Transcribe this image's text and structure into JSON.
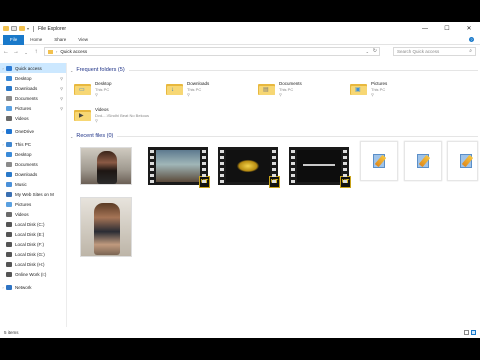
{
  "window": {
    "title": "File Explorer",
    "controls": {
      "minimize": "—",
      "maximize": "☐",
      "close": "✕"
    }
  },
  "ribbon": {
    "tabs": [
      {
        "label": "File",
        "active": true
      },
      {
        "label": "Home"
      },
      {
        "label": "Share"
      },
      {
        "label": "View"
      }
    ],
    "help": "?"
  },
  "address": {
    "back": "←",
    "forward": "→",
    "history": "⌄",
    "up": "↑",
    "breadcrumb": "Quick access",
    "separator": "›",
    "dropdown": "⌄",
    "refresh": "↻"
  },
  "search": {
    "placeholder": "Search Quick access",
    "icon": "search-icon"
  },
  "sidebar": {
    "items": [
      {
        "label": "Quick access",
        "icon": "star-icon",
        "color": "#2b7bd6",
        "expand": "›",
        "selected": true
      },
      {
        "label": "Desktop",
        "icon": "desktop-icon",
        "color": "#3a8ad8",
        "pinned": true
      },
      {
        "label": "Downloads",
        "icon": "download-icon",
        "color": "#2a79c9",
        "pinned": true
      },
      {
        "label": "Documents",
        "icon": "documents-icon",
        "color": "#8a8a8a",
        "pinned": true
      },
      {
        "label": "Pictures",
        "icon": "pictures-icon",
        "color": "#5aa0e0",
        "pinned": true
      },
      {
        "label": "Videos",
        "icon": "videos-icon",
        "color": "#6a6a6a"
      },
      {
        "label": "OneDrive",
        "icon": "cloud-icon",
        "color": "#1e74d1",
        "expand": "›",
        "gapBefore": true
      },
      {
        "label": "This PC",
        "icon": "computer-icon",
        "color": "#3f86cf",
        "expand": "›",
        "gapBefore": true
      },
      {
        "label": "Desktop",
        "icon": "desktop-icon",
        "color": "#3a8ad8"
      },
      {
        "label": "Documents",
        "icon": "documents-icon",
        "color": "#8a8a8a"
      },
      {
        "label": "Downloads",
        "icon": "download-icon",
        "color": "#2a79c9"
      },
      {
        "label": "Music",
        "icon": "music-icon",
        "color": "#4a90d9"
      },
      {
        "label": "My Web Sites on M",
        "icon": "network-folder-icon",
        "color": "#3a6fb2"
      },
      {
        "label": "Pictures",
        "icon": "pictures-icon",
        "color": "#5aa0e0"
      },
      {
        "label": "Videos",
        "icon": "videos-icon",
        "color": "#6a6a6a"
      },
      {
        "label": "Local Disk (C:)",
        "icon": "drive-icon",
        "color": "#555555"
      },
      {
        "label": "Local Disk (E:)",
        "icon": "drive-icon",
        "color": "#555555"
      },
      {
        "label": "Local Disk (F:)",
        "icon": "drive-icon",
        "color": "#555555"
      },
      {
        "label": "Local Disk (G:)",
        "icon": "drive-icon",
        "color": "#555555"
      },
      {
        "label": "Local Disk (H:)",
        "icon": "drive-icon",
        "color": "#555555"
      },
      {
        "label": "Online Work (I:)",
        "icon": "drive-icon",
        "color": "#555555"
      },
      {
        "label": "Network",
        "icon": "network-icon",
        "color": "#2f74c4",
        "expand": "›",
        "gapBefore": true
      }
    ]
  },
  "content": {
    "frequent_header": "Frequent folders (5)",
    "recent_header": "Recent files (0)",
    "collapse_glyph": "⌄",
    "folders": [
      {
        "name": "Desktop",
        "sub": "This PC",
        "icon": "desktop-folder-icon",
        "glyph": "▭",
        "glyph_color": "#2b7bd6"
      },
      {
        "name": "Downloads",
        "sub": "This PC",
        "icon": "downloads-folder-icon",
        "glyph": "↓",
        "glyph_color": "#1e6fc1"
      },
      {
        "name": "Documents",
        "sub": "This PC",
        "icon": "documents-folder-icon",
        "glyph": "▤",
        "glyph_color": "#7a7a7a"
      },
      {
        "name": "Pictures",
        "sub": "This PC",
        "icon": "pictures-folder-icon",
        "glyph": "▣",
        "glyph_color": "#3f8fd8"
      },
      {
        "name": "Videos",
        "sub": "Dvd-...\\Sindhi Beat No Bekous",
        "icon": "videos-folder-icon",
        "glyph": "▶",
        "glyph_color": "#444444"
      }
    ],
    "pin_glyph": "⚲",
    "recent": [
      {
        "kind": "photo",
        "icon": "photo-thumbnail-1"
      },
      {
        "kind": "video",
        "icon": "video-thumbnail-1",
        "badge": "UT"
      },
      {
        "kind": "video",
        "icon": "video-thumbnail-2",
        "badge": "UT"
      },
      {
        "kind": "video",
        "icon": "video-thumbnail-3",
        "badge": "UT"
      },
      {
        "kind": "doc",
        "icon": "document-thumbnail-1"
      },
      {
        "kind": "doc",
        "icon": "document-thumbnail-2"
      },
      {
        "kind": "doc",
        "icon": "document-thumbnail-3"
      },
      {
        "kind": "photo",
        "icon": "photo-thumbnail-2"
      }
    ]
  },
  "status": {
    "items": "5 items",
    "view_details": "details-view-icon",
    "view_tiles": "large-icons-view-icon"
  }
}
